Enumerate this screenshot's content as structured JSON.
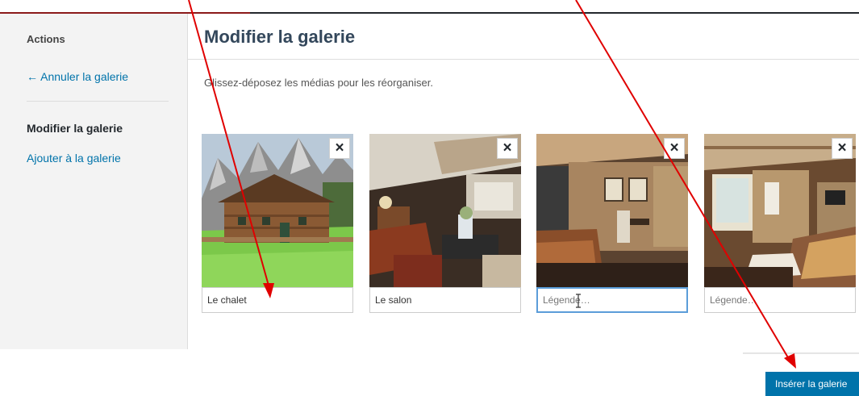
{
  "sidebar": {
    "heading": "Actions",
    "cancel_link": "← Annuler la galerie",
    "current_item": "Modifier la galerie",
    "add_link": "Ajouter à la galerie"
  },
  "main": {
    "title": "Modifier la galerie",
    "instructions": "Glissez-déposez les médias pour les réorganiser.",
    "thumbnails": [
      {
        "caption": "Le chalet",
        "placeholder": "Légende…",
        "remove": "×"
      },
      {
        "caption": "Le salon",
        "placeholder": "Légende…",
        "remove": "×"
      },
      {
        "caption": "",
        "placeholder": "Légende…",
        "remove": "×"
      },
      {
        "caption": "",
        "placeholder": "Légende…",
        "remove": "×"
      }
    ]
  },
  "footer": {
    "insert_button": "Insérer la galerie"
  },
  "colors": {
    "link": "#0073aa",
    "button": "#0073aa",
    "annotation_arrow": "#e00000",
    "focus": "#5b9dd9"
  }
}
